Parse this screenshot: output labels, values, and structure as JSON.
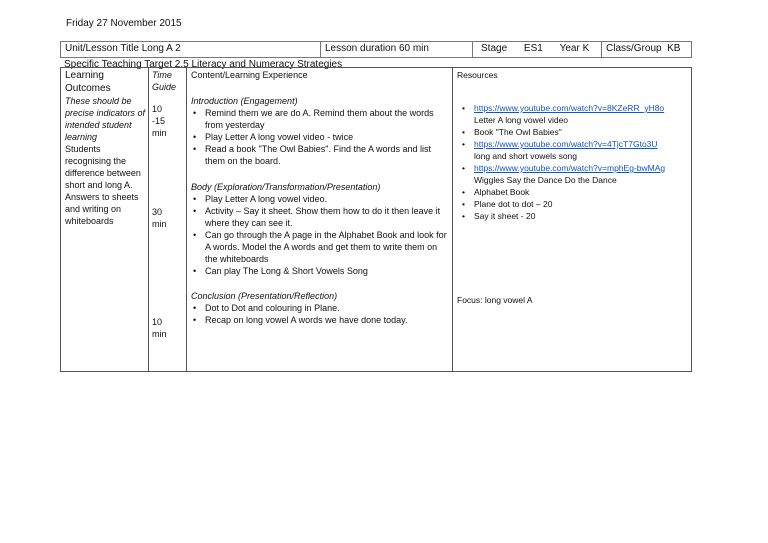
{
  "date": "Friday 27 November 2015",
  "header": {
    "unit": "Unit/Lesson Title Long A 2",
    "duration": "Lesson duration 60 min",
    "stage_label": "Stage",
    "stage": "ES1",
    "year_label": "Year K",
    "class_group": "Class/Group  KB"
  },
  "target": "Specific Teaching Target 2.5 Literacy and Numeracy Strategies",
  "outcomes": {
    "title1": "Learning",
    "title2": "Outcomes",
    "desc": "These should be precise indicators of intended student learning",
    "text": "Students recognising the difference between short and long A. Answers to sheets and writing on whiteboards"
  },
  "time": {
    "title1": "Time",
    "title2": "Guide",
    "t1a": "10",
    "t1b": "-15",
    "t1c": "min",
    "t2a": "30",
    "t2b": "min",
    "t3a": "10",
    "t3b": "min"
  },
  "content": {
    "title": "Content/Learning Experience",
    "intro": "Introduction (Engagement)",
    "intro_items": [
      "Remind them we are do A. Remind them about the words from yesterday",
      "Play Letter A long vowel video - twice",
      "Read a book \"The Owl Babies\". Find the A words and list them on the board."
    ],
    "body": "Body (Exploration/Transformation/Presentation)",
    "body_items": [
      "Play Letter A long vowel video.",
      "Activity – Say it sheet. Show them how to do it then leave it where they can see it.",
      "Can go through the A page in the Alphabet Book and look for A words. Model the A words and get them to write them on the whiteboards",
      "Can play The Long & Short Vowels Song"
    ],
    "conclusion": "Conclusion (Presentation/Reflection)",
    "conclusion_items": [
      "Dot to Dot and colouring in Plane.",
      "Recap on long vowel A words we have done today."
    ]
  },
  "resources": {
    "title": "Resources",
    "link1": "https://www.youtube.com/watch?v=8KZeRR_yH8o",
    "link1_desc": "Letter A long vowel video",
    "item2": "Book \"The Owl Babies\"",
    "link2": "https://www.youtube.com/watch?v=4TjcT7Gto3U",
    "link2_desc": "long and short vowels song",
    "link3": "https://www.youtube.com/watch?v=mphEg-bwMAg",
    "link3_desc": "Wiggles Say the Dance Do the Dance",
    "item4": "Alphabet Book",
    "item5": "Plane dot to dot – 20",
    "item6": "Say it sheet - 20",
    "focus": "Focus: long vowel A"
  }
}
